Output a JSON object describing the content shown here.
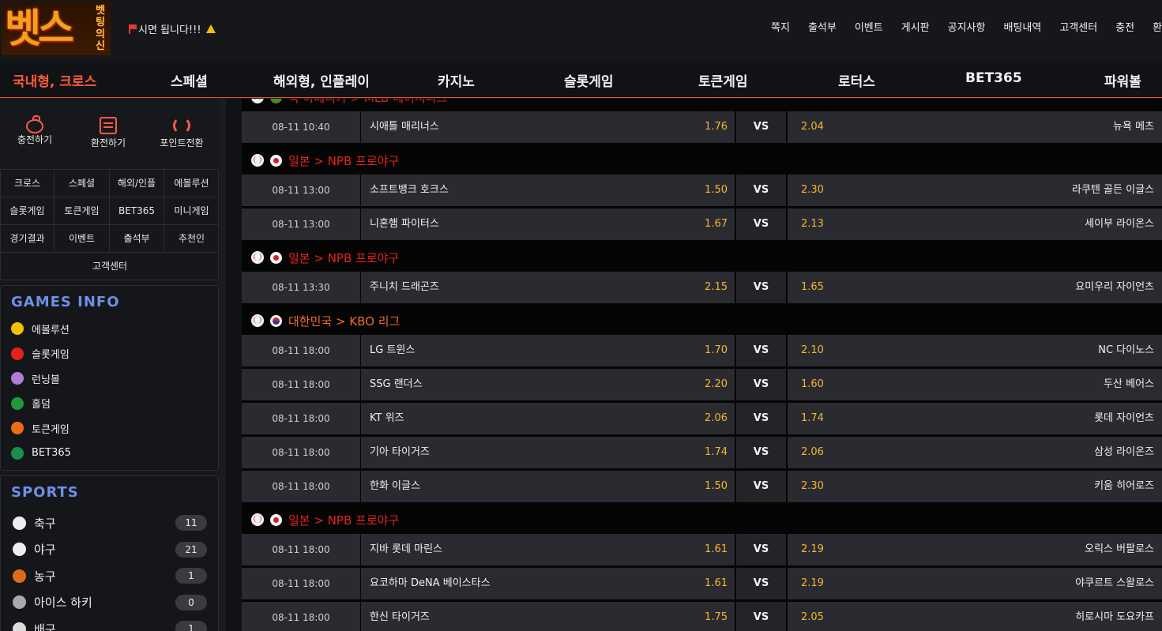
{
  "brand": {
    "main": "벳스",
    "side": "벳팅의신"
  },
  "notice": {
    "text": "시면 됩니다!!!"
  },
  "top_menu": [
    "쪽지",
    "출석부",
    "이벤트",
    "게시판",
    "공지사항",
    "배팅내역",
    "고객센터",
    "충전",
    "환전"
  ],
  "main_nav": [
    {
      "label": "국내형, 크로스",
      "active": true
    },
    {
      "label": "스페셜"
    },
    {
      "label": "해외형, 인플레이"
    },
    {
      "label": "카지노"
    },
    {
      "label": "슬롯게임"
    },
    {
      "label": "토큰게임"
    },
    {
      "label": "로터스"
    },
    {
      "label": "BET365"
    },
    {
      "label": "파워볼"
    }
  ],
  "quick_actions": [
    {
      "label": "충전하기",
      "icon": "piggy-bank-icon"
    },
    {
      "label": "환전하기",
      "icon": "exchange-icon"
    },
    {
      "label": "포인트전환",
      "icon": "refresh-icon"
    }
  ],
  "grid_menu": [
    [
      "크로스",
      "스페셜",
      "해외/인플",
      "에볼루션"
    ],
    [
      "슬롯게임",
      "토큰게임",
      "BET365",
      "미니게임"
    ],
    [
      "경기결과",
      "이벤트",
      "출석부",
      "추천인"
    ],
    [
      "고객센터"
    ]
  ],
  "games_info": {
    "title": "GAMES INFO",
    "items": [
      {
        "label": "에볼루션",
        "icon": "evolution-icon",
        "color": "#f2c200"
      },
      {
        "label": "슬롯게임",
        "icon": "slot-icon",
        "color": "#e8221b"
      },
      {
        "label": "런닝볼",
        "icon": "runningball-icon",
        "color": "#b07cd8"
      },
      {
        "label": "홀덤",
        "icon": "clover-icon",
        "color": "#1f9a3a"
      },
      {
        "label": "토큰게임",
        "icon": "token-icon",
        "color": "#f06a1a"
      },
      {
        "label": "BET365",
        "icon": "bet365-icon",
        "color": "#1a8f4c"
      }
    ]
  },
  "sports": {
    "title": "SPORTS",
    "items": [
      {
        "label": "축구",
        "count": "11",
        "icon": "soccer-icon"
      },
      {
        "label": "야구",
        "count": "21",
        "icon": "baseball-icon"
      },
      {
        "label": "농구",
        "count": "1",
        "icon": "basketball-icon"
      },
      {
        "label": "아이스 하키",
        "count": "0",
        "icon": "hockey-icon"
      },
      {
        "label": "배구",
        "count": "1",
        "icon": "volleyball-icon"
      }
    ]
  },
  "matches": {
    "partial_league": "북 아메리카 > MLB 메이저리그",
    "vs_label": "VS",
    "blocks": [
      {
        "league": null,
        "games": [
          {
            "time": "08-11 10:40",
            "home": "시애틀 매리너스",
            "home_odd": "1.76",
            "away": "뉴욕 메츠",
            "away_odd": "2.04"
          }
        ]
      },
      {
        "league": "일본 > NPB 프로야구",
        "flag": "jp",
        "color": "#e8221b",
        "games": [
          {
            "time": "08-11 13:00",
            "home": "소프트뱅크 호크스",
            "home_odd": "1.50",
            "away": "라쿠텐 골든 이글스",
            "away_odd": "2.30"
          },
          {
            "time": "08-11 13:00",
            "home": "니혼햄 파이터스",
            "home_odd": "1.67",
            "away": "세이부 라이온스",
            "away_odd": "2.13"
          }
        ]
      },
      {
        "league": "일본 > NPB 프로야구",
        "flag": "jp",
        "color": "#e8221b",
        "games": [
          {
            "time": "08-11 13:30",
            "home": "주니치 드래곤즈",
            "home_odd": "2.15",
            "away": "요미우리 자이언츠",
            "away_odd": "1.65"
          }
        ]
      },
      {
        "league": "대한민국 > KBO 리그",
        "flag": "kr",
        "color": "#f26b2a",
        "games": [
          {
            "time": "08-11 18:00",
            "home": "LG 트윈스",
            "home_odd": "1.70",
            "away": "NC 다이노스",
            "away_odd": "2.10"
          },
          {
            "time": "08-11 18:00",
            "home": "SSG 랜더스",
            "home_odd": "2.20",
            "away": "두산 베어스",
            "away_odd": "1.60"
          },
          {
            "time": "08-11 18:00",
            "home": "KT 위즈",
            "home_odd": "2.06",
            "away": "롯데 자이언츠",
            "away_odd": "1.74"
          },
          {
            "time": "08-11 18:00",
            "home": "기아 타이거즈",
            "home_odd": "1.74",
            "away": "삼성 라이온즈",
            "away_odd": "2.06"
          },
          {
            "time": "08-11 18:00",
            "home": "한화 이글스",
            "home_odd": "1.50",
            "away": "키움 히어로즈",
            "away_odd": "2.30"
          }
        ]
      },
      {
        "league": "일본 > NPB 프로야구",
        "flag": "jp",
        "color": "#e8221b",
        "games": [
          {
            "time": "08-11 18:00",
            "home": "지바 롯데 마린스",
            "home_odd": "1.61",
            "away": "오릭스 버팔로스",
            "away_odd": "2.19"
          },
          {
            "time": "08-11 18:00",
            "home": "요코하마 DeNA 베이스타스",
            "home_odd": "1.61",
            "away": "야쿠르트 스왈로스",
            "away_odd": "2.19"
          },
          {
            "time": "08-11 18:00",
            "home": "한신 타이거즈",
            "home_odd": "1.75",
            "away": "히로시마 도요카프",
            "away_odd": "2.05"
          }
        ]
      }
    ]
  }
}
